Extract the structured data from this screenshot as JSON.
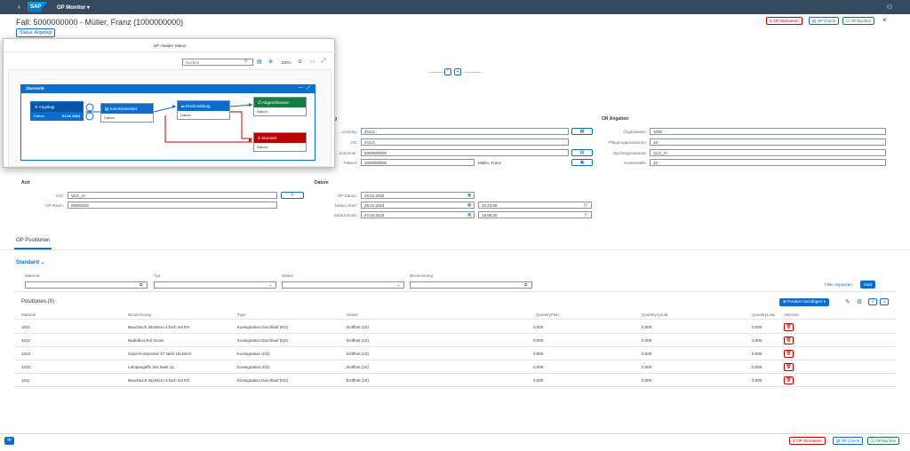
{
  "shell": {
    "app_title": "OP Monitor",
    "logo": "SAP",
    "back_icon": "back-icon",
    "user_icon": "user-icon"
  },
  "header": {
    "title": "Fall: 5000000000 - Müller, Franz (1000000000)",
    "status_button": "Status: Angelegt",
    "actions": {
      "storno": "OP Stornieren",
      "check": "OP Check",
      "buchen": "OP Buchen"
    }
  },
  "colors": {
    "brand": "#0a6ed1",
    "shell": "#354a5f",
    "red": "#bb0000",
    "green": "#107e3e"
  },
  "popover": {
    "title": "OP Header Status",
    "search_placeholder": "Suchen",
    "zoom": "100%",
    "lane_title": "Übersicht",
    "nodes": [
      {
        "title": "Angelegt",
        "label": "Datum",
        "date": "01.01.2024"
      },
      {
        "title": "Kommissioniert",
        "label": "Datum"
      },
      {
        "title": "Rückmeldung",
        "label": "Datum"
      },
      {
        "title": "Abgeschlossen",
        "label": "Datum"
      },
      {
        "title": "Storniert",
        "label": "Datum"
      }
    ]
  },
  "form": {
    "left_fields": [
      {
        "label": "...ichnung:",
        "value": "ZVLG"
      },
      {
        "label": "Ort:",
        "value": "ZVLG"
      },
      {
        "label": "...ilnummer:",
        "value": "5000000000"
      },
      {
        "label": "Patient:",
        "value": "1000000000",
        "extra": "Müller, Franz"
      }
    ],
    "or_section": "OR Angaben",
    "or_fields": [
      {
        "label": "Organisation:",
        "value": "1000"
      },
      {
        "label": "Pflegeorganisationen:",
        "value": "10"
      },
      {
        "label": "Buchungsvariante:",
        "value": "VLG_AI"
      },
      {
        "label": "Kostenstelle:",
        "value": "10"
      }
    ],
    "arzt_section": "Arzt",
    "arzt_fields": [
      {
        "label": "Arzt:",
        "value": "VLG_AI"
      },
      {
        "label": "OP Raum:",
        "value": "00000102"
      }
    ],
    "datum_section": "Datum",
    "datum_fields": [
      {
        "label": "OP Datum:",
        "value": "26.01.2024"
      },
      {
        "label": "Datum Start:",
        "value": "25.01.2024",
        "time": "10:23:00"
      },
      {
        "label": "Datum Ende:",
        "value": "23.02.2024",
        "time": "18:56:00"
      }
    ]
  },
  "tabs": {
    "active": "OP Positionen"
  },
  "filters": {
    "variant": "Standard",
    "fields": [
      {
        "label": "Material:"
      },
      {
        "label": "Typ:"
      },
      {
        "label": "Status:"
      },
      {
        "label": "Bezeichnung:"
      }
    ],
    "adapt": "Filter anpassen",
    "start": "Start"
  },
  "table": {
    "title": "Positionen (5)",
    "add_button": "Position hinzufügen",
    "columns": [
      "Material",
      "Bezeichnung",
      "Type",
      "Status",
      "QuantityPlan",
      "QuantityActual",
      "QuantityLoss",
      "Aktionen"
    ],
    "rows": [
      {
        "material": "1011",
        "bezeichnung": "Bauchtuch 45x45cm 4-fach mit RX",
        "type": "Konsignation Durchlauf (KD)",
        "status": "Eröffnet (10)",
        "plan": "0.000",
        "actual": "0.000",
        "loss": "0.000"
      },
      {
        "material": "1012",
        "bezeichnung": "Nadelbox Rot Gross",
        "type": "Konsignation Durchlauf (KD)",
        "status": "Eröffnet (10)",
        "plan": "0.000",
        "actual": "0.000",
        "loss": "0.000"
      },
      {
        "material": "1013",
        "bezeichnung": "Gaze-Kompresse 17 steril 10x20cm",
        "type": "Konsignation (KO)",
        "status": "Eröffnet (10)",
        "plan": "0.000",
        "actual": "0.000",
        "loss": "0.000"
      },
      {
        "material": "1010",
        "bezeichnung": "Lampengriffe Set Sask 11",
        "type": "Konsignation (KO)",
        "status": "Eröffnet (10)",
        "plan": "0.000",
        "actual": "0.000",
        "loss": "0.000"
      },
      {
        "material": "1011",
        "bezeichnung": "Bauchtuch 45x45cm 4-fach mit RX",
        "type": "Konsignation Durchlauf (KD)",
        "status": "Eröffnet (10)",
        "plan": "0.000",
        "actual": "0.000",
        "loss": "0.000"
      }
    ]
  }
}
